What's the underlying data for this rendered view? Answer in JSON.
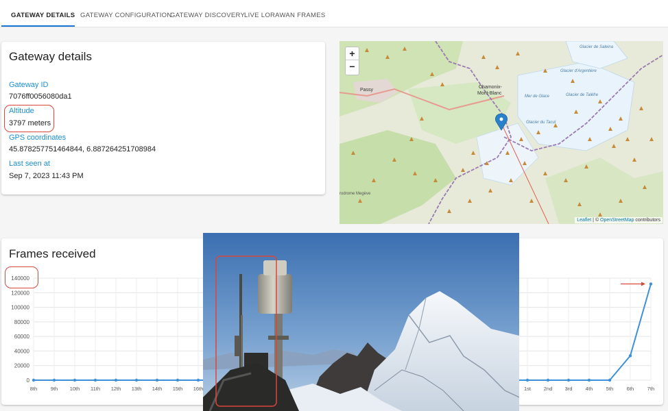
{
  "tabs": [
    {
      "label": "GATEWAY DETAILS",
      "active": true
    },
    {
      "label": "GATEWAY CONFIGURATION",
      "active": false
    },
    {
      "label": "GATEWAY DISCOVERY",
      "active": false
    },
    {
      "label": "LIVE LORAWAN FRAMES",
      "active": false
    }
  ],
  "details": {
    "title": "Gateway details",
    "gateway_id_label": "Gateway ID",
    "gateway_id": "7076ff0056080da1",
    "altitude_label": "Altitude",
    "altitude": "3797 meters",
    "gps_label": "GPS coordinates",
    "gps": "45.878257751464844, 6.887264251708984",
    "last_seen_label": "Last seen at",
    "last_seen": "Sep 7, 2023 11:43 PM"
  },
  "map": {
    "zoom_in": "+",
    "zoom_out": "−",
    "place_passy": "Passy",
    "place_chamonix_1": "Chamonix-",
    "place_chamonix_2": "Mont-Blanc",
    "place_glacier_argentiere": "Glacier d'Argentière",
    "place_mer_de_glace": "Mer de Glace",
    "place_glacier_talefre": "Glacier de Talèfre",
    "place_glacier_tacul": "Glacier du Tacul",
    "place_saleina": "Glacier de Saleina",
    "place_aerodrome": "rodrome Megève",
    "attribution_leaflet": "Leaflet",
    "attribution_sep": " | © ",
    "attribution_osm": "OpenStreetMap",
    "attribution_rest": " contributors"
  },
  "frames": {
    "title": "Frames received"
  },
  "chart_data": {
    "type": "line",
    "title": "Frames received",
    "y_ticks": [
      "140000",
      "120000",
      "100000",
      "80000",
      "60000",
      "40000",
      "20000",
      "0"
    ],
    "ylim": [
      0,
      140000
    ],
    "grid": true,
    "color": "#3d8fdc",
    "visible_points": [
      {
        "x": "8th",
        "y": 0
      },
      {
        "x": "9th",
        "y": 0
      },
      {
        "x": "10th",
        "y": 0
      },
      {
        "x": "11th",
        "y": 0
      },
      {
        "x": "12th",
        "y": 0
      },
      {
        "x": "13th",
        "y": 0
      },
      {
        "x": "14th",
        "y": 0
      },
      {
        "x": "15th",
        "y": 0
      },
      {
        "x": "16th",
        "y": 0
      },
      {
        "x": "1st",
        "y": 0
      },
      {
        "x": "2nd",
        "y": 0
      },
      {
        "x": "3rd",
        "y": 0
      },
      {
        "x": "4th",
        "y": 0
      },
      {
        "x": "5th",
        "y": 0
      },
      {
        "x": "6th",
        "y": 33500
      },
      {
        "x": "7th",
        "y": 132000
      }
    ]
  }
}
